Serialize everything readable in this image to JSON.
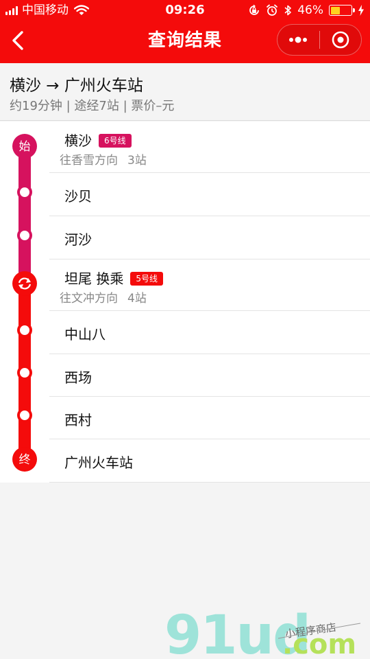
{
  "status_bar": {
    "carrier": "中国移动",
    "time": "09:26",
    "battery": "46%",
    "battery_level": 0.46
  },
  "nav": {
    "title": "查询结果"
  },
  "summary": {
    "route_title": "横沙 → 广州火车站",
    "meta": "约19分钟 | 途经7站 | 票价–元"
  },
  "colors": {
    "brand_red": "#f40b0b",
    "line6": "#d6125e",
    "line5": "#f40b0b"
  },
  "timeline": {
    "start_marker": "始",
    "end_marker": "终"
  },
  "stations": [
    {
      "name": "横沙",
      "badge": "6号线",
      "direction": "往香雪方向",
      "count": "3站"
    },
    {
      "name": "沙贝"
    },
    {
      "name": "河沙"
    },
    {
      "name": "坦尾 换乘",
      "badge": "5号线",
      "direction": "往文冲方向",
      "count": "4站"
    },
    {
      "name": "中山八"
    },
    {
      "name": "西场"
    },
    {
      "name": "西村"
    },
    {
      "name": "广州火车站"
    }
  ],
  "watermark": {
    "logo": "91ud",
    "domain": ".com",
    "tagline": "小程序商店"
  },
  "icons": {
    "back": "chevron-left-icon",
    "more": "more-dots-icon",
    "close": "target-circle-icon",
    "transfer": "transfer-icon",
    "wifi": "wifi-icon",
    "bluetooth": "bluetooth-icon",
    "alarm": "alarm-icon",
    "lock": "rotation-lock-icon"
  }
}
